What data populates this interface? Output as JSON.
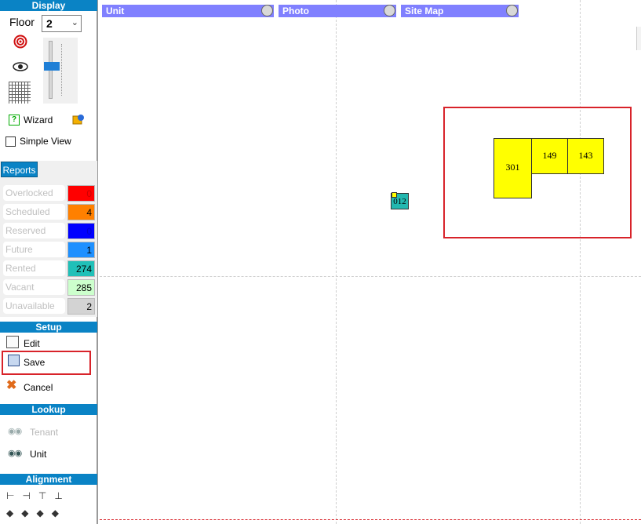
{
  "sidebar": {
    "display": {
      "header": "Display",
      "floor_label": "Floor",
      "floor_value": "2",
      "wizard_label": "Wizard",
      "simple_view_label": "Simple View",
      "simple_view_checked": false,
      "slider_level_percent": 55
    },
    "reports": {
      "tab_label": "Reports",
      "items": [
        {
          "label": "Overlocked",
          "value": "0",
          "color": "#ff0000",
          "text_color": "#cc0000"
        },
        {
          "label": "Scheduled",
          "value": "4",
          "color": "#ff8000",
          "text_color": "#000000"
        },
        {
          "label": "Reserved",
          "value": "0",
          "color": "#0000ff",
          "text_color": "#0000cc"
        },
        {
          "label": "Future MoveIn",
          "value": "1",
          "color": "#1e90ff",
          "text_color": "#000000"
        },
        {
          "label": "Rented",
          "value": "274",
          "color": "#20c0b8",
          "text_color": "#000000"
        },
        {
          "label": "Vacant",
          "value": "285",
          "color": "#ccffcc",
          "text_color": "#000000"
        },
        {
          "label": "Unavailable",
          "value": "2",
          "color": "#d3d3d3",
          "text_color": "#000000"
        }
      ]
    },
    "setup": {
      "header": "Setup",
      "edit_label": "Edit",
      "save_label": "Save",
      "cancel_label": "Cancel"
    },
    "lookup": {
      "header": "Lookup",
      "tenant_label": "Tenant",
      "unit_label": "Unit"
    },
    "alignment": {
      "header": "Alignment"
    }
  },
  "canvas": {
    "legends": [
      {
        "label": "Unit"
      },
      {
        "label": "Photo"
      },
      {
        "label": "Site Map"
      }
    ],
    "units": [
      {
        "number": "301",
        "color": "#ffff00"
      },
      {
        "number": "149",
        "color": "#ffff00"
      },
      {
        "number": "143",
        "color": "#ffff00"
      },
      {
        "number": "012",
        "color": "#23b8b0"
      }
    ]
  }
}
